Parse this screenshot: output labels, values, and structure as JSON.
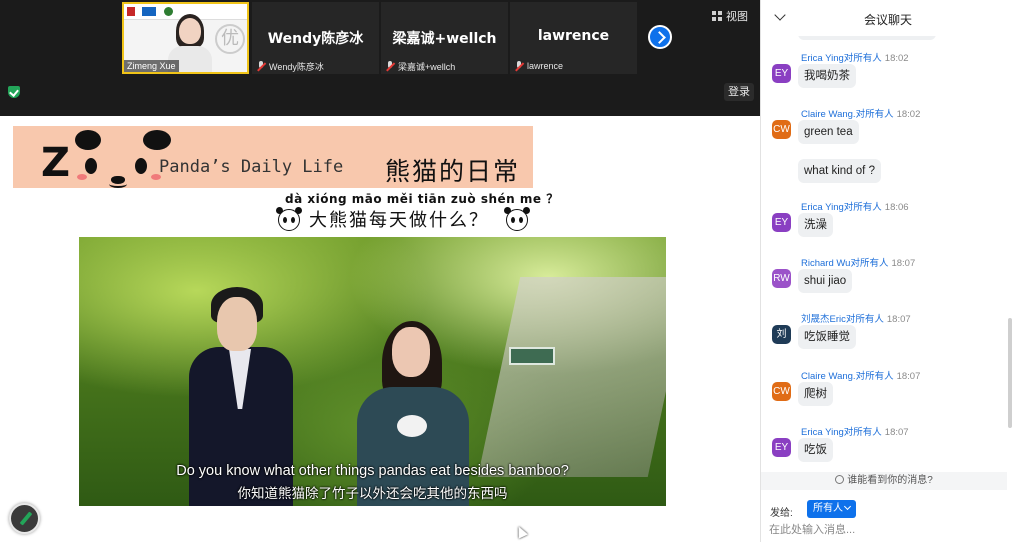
{
  "gallery": {
    "self_tile": {
      "name": "Zimeng Xue"
    },
    "tiles": [
      {
        "name": "Wendy陈彦冰",
        "label": "Wendy陈彦冰",
        "muted": true
      },
      {
        "name": "梁嘉诚+wellch",
        "label": "梁嘉诚+wellch",
        "muted": true
      },
      {
        "name": "lawrence",
        "label": "lawrence",
        "muted": true
      }
    ],
    "view_label": "视图",
    "login_label": "登录"
  },
  "slide": {
    "title_letter": "Z",
    "title_en": "Panda’s Daily Life",
    "title_cn": "熊猫的日常",
    "pinyin": "dà xióng māo měi tiān zuò shén me ？",
    "question": "大熊猫每天做什么？",
    "caption_en": "Do you know what other things pandas eat besides bamboo?",
    "caption_cn": "你知道熊猫除了竹子以外还会吃其他的东西吗"
  },
  "chat": {
    "title": "会议聊天",
    "messages": [
      {
        "sender": "Erica  Ying",
        "to": "对所有人",
        "time": "18:02",
        "avatar": "EY",
        "avatar_color": "#8a3fc2",
        "text": "我喝奶茶"
      },
      {
        "sender": "Claire Wang.",
        "to": "对所有人",
        "time": "18:02",
        "avatar": "CW",
        "avatar_color": "#e06c16",
        "text": "green tea"
      },
      {
        "sender": "",
        "to": "",
        "time": "",
        "avatar": "",
        "avatar_color": "",
        "text": "what kind of ?"
      },
      {
        "sender": "Erica  Ying",
        "to": "对所有人",
        "time": "18:06",
        "avatar": "EY",
        "avatar_color": "#8a3fc2",
        "text": "洗澡"
      },
      {
        "sender": "Richard Wu",
        "to": "对所有人",
        "time": "18:07",
        "avatar": "RW",
        "avatar_color": "#9b52c9",
        "text": "shui jiao"
      },
      {
        "sender": "刘晟杰Eric",
        "to": "对所有人",
        "time": "18:07",
        "avatar": "刘",
        "avatar_color": "#1f3b57",
        "text": "吃饭睡觉"
      },
      {
        "sender": "Claire Wang.",
        "to": "对所有人",
        "time": "18:07",
        "avatar": "CW",
        "avatar_color": "#e06c16",
        "text": "爬树"
      },
      {
        "sender": "Erica  Ying",
        "to": "对所有人",
        "time": "18:07",
        "avatar": "EY",
        "avatar_color": "#8a3fc2",
        "text": "吃饭"
      }
    ],
    "who_can_see": "谁能看到你的消息?",
    "send_to_label": "发给:",
    "recipient": "所有人",
    "input_placeholder": "在此处输入消息..."
  },
  "icons": {
    "self_view_icon": "grid-icon",
    "security": "shield-check-icon",
    "annotate": "pencil-icon",
    "next_page": "chevron-right-icon"
  }
}
